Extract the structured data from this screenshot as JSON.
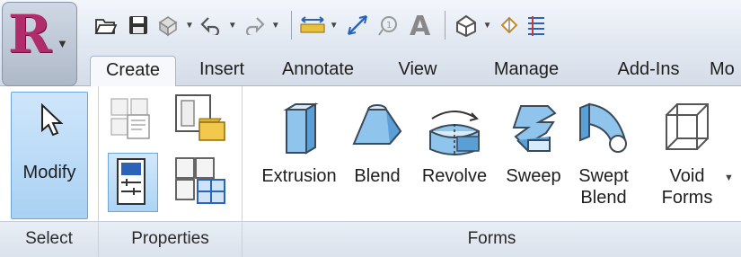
{
  "app": {
    "logo_letter": "R"
  },
  "quick_access": {
    "icons": [
      "open-icon",
      "save-icon",
      "sync-icon",
      "undo-icon",
      "redo-icon",
      "measure-icon",
      "dimension-icon",
      "tag-icon",
      "text-icon",
      "3d-view-icon",
      "section-icon",
      "thin-lines-icon"
    ]
  },
  "tabs": [
    {
      "label": "Create",
      "active": true
    },
    {
      "label": "Insert",
      "active": false
    },
    {
      "label": "Annotate",
      "active": false
    },
    {
      "label": "View",
      "active": false
    },
    {
      "label": "Manage",
      "active": false
    },
    {
      "label": "Add-Ins",
      "active": false
    },
    {
      "label": "Mo",
      "active": false
    }
  ],
  "panels": {
    "select": {
      "label": "Select",
      "modify_label": "Modify"
    },
    "properties": {
      "label": "Properties"
    },
    "forms": {
      "label": "Forms",
      "buttons": [
        {
          "line1": "Extrusion",
          "line2": ""
        },
        {
          "line1": "Blend",
          "line2": ""
        },
        {
          "line1": "Revolve",
          "line2": ""
        },
        {
          "line1": "Sweep",
          "line2": ""
        },
        {
          "line1": "Swept",
          "line2": "Blend"
        },
        {
          "line1": "Void",
          "line2": "Forms"
        }
      ]
    }
  },
  "colors": {
    "accent_blue": "#5aa0d6",
    "selected_bg": "#b6d9f5",
    "logo": "#b12c6a"
  }
}
